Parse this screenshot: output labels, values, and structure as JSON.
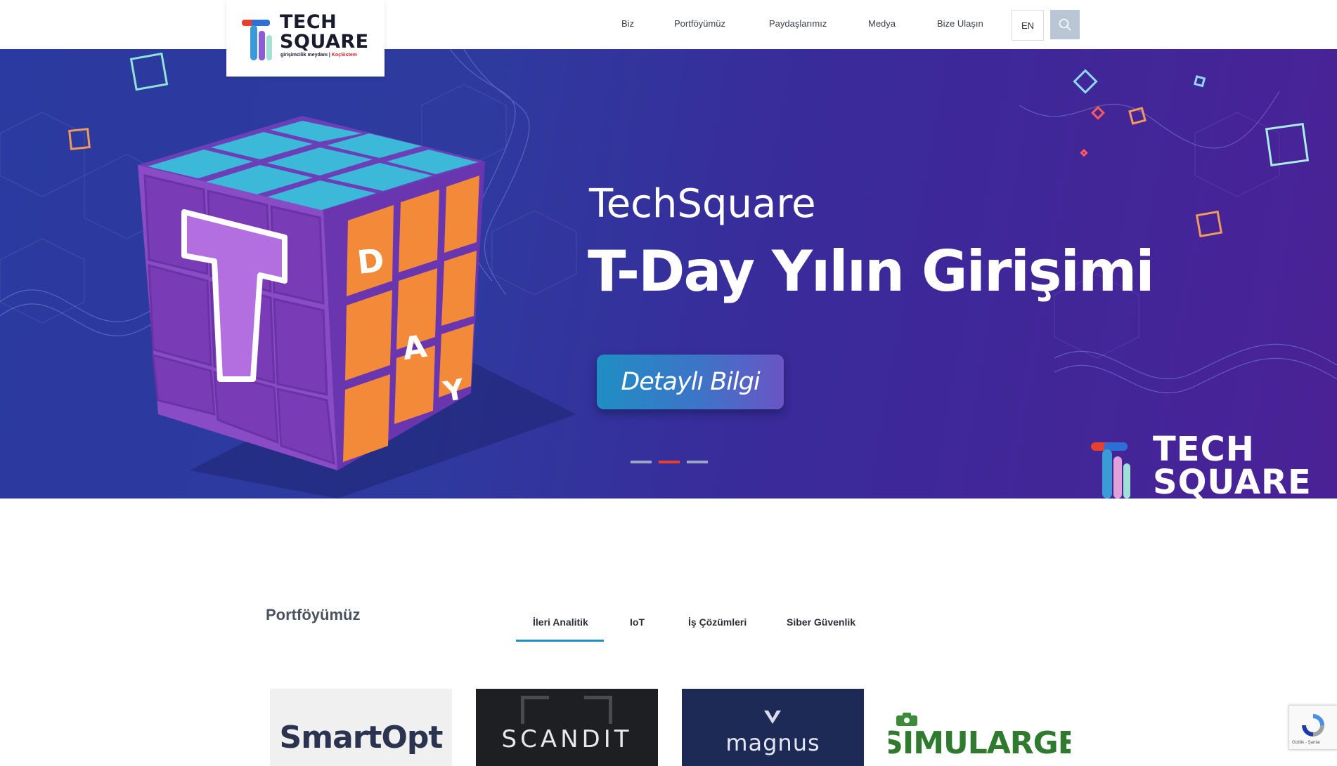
{
  "header": {
    "logo": {
      "line1": "TECH",
      "line2": "SQUARE",
      "sub_left": "girişimcilik meydanı |",
      "sub_brand": "KoçSistem"
    },
    "nav": [
      {
        "label": "Biz"
      },
      {
        "label": "Portföyümüz"
      },
      {
        "label": "Paydaşlarımız"
      },
      {
        "label": "Medya"
      },
      {
        "label": "Bize Ulaşın"
      }
    ],
    "lang_label": "EN",
    "search_icon": "search-icon"
  },
  "hero": {
    "line1": "TechSquare",
    "line2": "T-Day Yılın Girişimi",
    "cta_label": "Detaylı Bilgi",
    "cube_letters": [
      "T",
      "D",
      "A",
      "Y"
    ],
    "slide_count": 3,
    "active_slide": 2,
    "watermark_line1": "TECH",
    "watermark_line2": "SQUARE",
    "colors": {
      "accent": "#1f8ec4",
      "active_dot": "#e6402e"
    }
  },
  "portfolio": {
    "title": "Portföyümüz",
    "tabs": [
      {
        "label": "İleri Analitik",
        "active": true
      },
      {
        "label": "IoT",
        "active": false
      },
      {
        "label": "İş Çözümleri",
        "active": false
      },
      {
        "label": "Siber Güvenlik",
        "active": false
      }
    ],
    "cards": [
      {
        "name": "SmartOpt"
      },
      {
        "name": "SCANDIT"
      },
      {
        "name": "magnus"
      },
      {
        "name": "SIMULARGE"
      }
    ]
  },
  "recaptcha": {
    "text": "Gizlilik - Şartlar"
  }
}
